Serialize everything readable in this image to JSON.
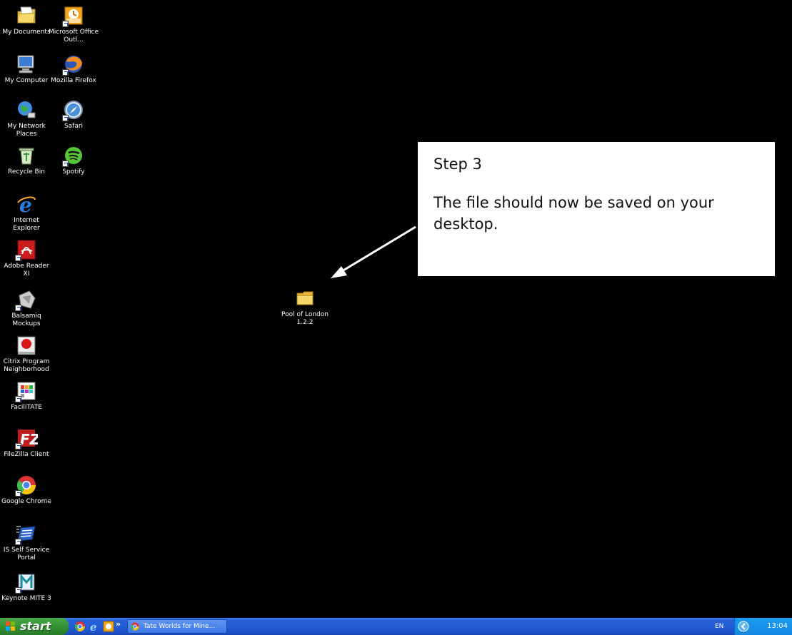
{
  "desktop": {
    "icons": [
      {
        "id": "my-documents",
        "label": "My Documents",
        "icon": "folder-documents-icon"
      },
      {
        "id": "outlook",
        "label": "Microsoft Office Outl...",
        "icon": "outlook-icon"
      },
      {
        "id": "my-computer",
        "label": "My Computer",
        "icon": "computer-icon"
      },
      {
        "id": "firefox",
        "label": "Mozilla Firefox",
        "icon": "firefox-icon"
      },
      {
        "id": "network",
        "label": "My Network Places",
        "icon": "network-icon"
      },
      {
        "id": "safari",
        "label": "Safari",
        "icon": "safari-icon"
      },
      {
        "id": "recycle",
        "label": "Recycle Bin",
        "icon": "recycle-bin-icon"
      },
      {
        "id": "spotify",
        "label": "Spotify",
        "icon": "spotify-icon"
      },
      {
        "id": "ie",
        "label": "Internet Explorer",
        "icon": "internet-explorer-icon"
      },
      {
        "id": "adobe",
        "label": "Adobe Reader XI",
        "icon": "adobe-reader-icon"
      },
      {
        "id": "balsamiq",
        "label": "Balsamiq Mockups",
        "icon": "balsamiq-icon"
      },
      {
        "id": "citrix",
        "label": "Citrix Program Neighborhood",
        "icon": "citrix-icon"
      },
      {
        "id": "facilitate",
        "label": "FaciliTATE",
        "icon": "facilitate-icon"
      },
      {
        "id": "filezilla",
        "label": "FileZilla Client",
        "icon": "filezilla-icon"
      },
      {
        "id": "chrome",
        "label": "Google Chrome",
        "icon": "chrome-icon"
      },
      {
        "id": "is-portal",
        "label": "IS Self Service Portal",
        "icon": "portal-icon"
      },
      {
        "id": "keynote",
        "label": "Keynote MITE 3",
        "icon": "keynote-icon"
      },
      {
        "id": "pool",
        "label": "Pool of London 1.2.2",
        "icon": "folder-icon"
      }
    ]
  },
  "callout": {
    "title": "Step 3",
    "body": "The file should now be saved on your desktop."
  },
  "taskbar": {
    "start_label": "start",
    "quicklaunch_chevron": "»",
    "task_button_label": "Tate Worlds for Mine...",
    "language": "EN",
    "clock": "13:04"
  }
}
